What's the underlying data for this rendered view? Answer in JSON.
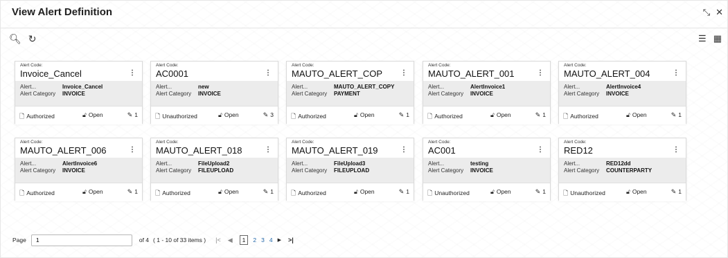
{
  "header": {
    "title": "View Alert Definition",
    "window_icons": [
      "expand-icon",
      "close-icon"
    ]
  },
  "toolbar": {
    "icons": [
      "search-icon",
      "refresh-icon"
    ]
  },
  "view_toggle": {
    "icons": [
      "list-view-icon",
      "grid-view-icon"
    ]
  },
  "labels": {
    "alert_code": "Alert Code:",
    "alert": "Alert...",
    "alert_category": "Alert Category",
    "open": "Open"
  },
  "cards": [
    {
      "code": "Invoice_Cancel",
      "alert": "Invoice_Cancel",
      "category": "INVOICE",
      "status": "Authorized",
      "edits": "1"
    },
    {
      "code": "AC0001",
      "alert": "new",
      "category": "INVOICE",
      "status": "Unauthorized",
      "edits": "3"
    },
    {
      "code": "MAUTO_ALERT_COP",
      "alert": "MAUTO_ALERT_COPY",
      "category": "PAYMENT",
      "status": "Authorized",
      "edits": "1"
    },
    {
      "code": "MAUTO_ALERT_001",
      "alert": "AlertInvoice1",
      "category": "INVOICE",
      "status": "Authorized",
      "edits": "1"
    },
    {
      "code": "MAUTO_ALERT_004",
      "alert": "AlertInvoice4",
      "category": "INVOICE",
      "status": "Authorized",
      "edits": "1"
    },
    {
      "code": "MAUTO_ALERT_006",
      "alert": "AlertInvoice6",
      "category": "INVOICE",
      "status": "Authorized",
      "edits": "1"
    },
    {
      "code": "MAUTO_ALERT_018",
      "alert": "FileUpload2",
      "category": "FILEUPLOAD",
      "status": "Authorized",
      "edits": "1"
    },
    {
      "code": "MAUTO_ALERT_019",
      "alert": "FileUpload3",
      "category": "FILEUPLOAD",
      "status": "Authorized",
      "edits": "1"
    },
    {
      "code": "AC001",
      "alert": "testing",
      "category": "INVOICE",
      "status": "Unauthorized",
      "edits": "1"
    },
    {
      "code": "RED12",
      "alert": "RED12dd",
      "category": "COUNTERPARTY",
      "status": "Unauthorized",
      "edits": "1"
    }
  ],
  "pagination": {
    "page_label": "Page",
    "page_value": "1",
    "of_text": "of 4",
    "range_text": "( 1 - 10 of 33 items )",
    "pages": [
      "1",
      "2",
      "3",
      "4"
    ],
    "current_page": "1"
  }
}
